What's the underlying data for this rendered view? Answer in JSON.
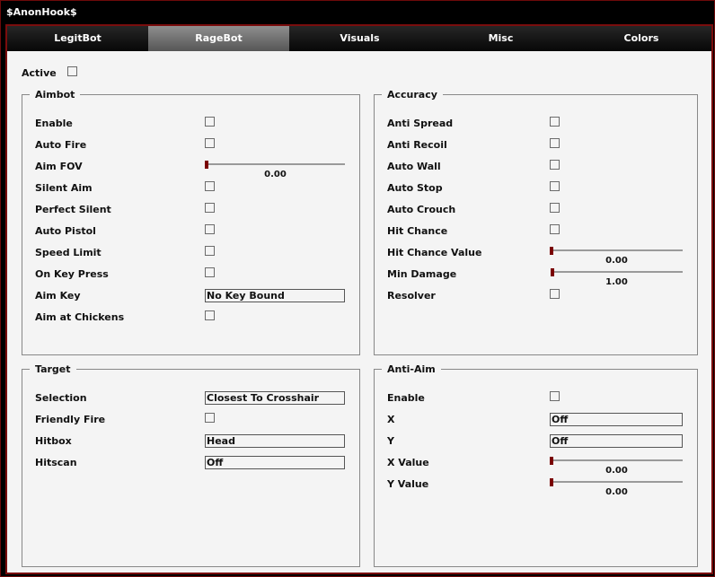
{
  "window": {
    "title": "$AnonHook$"
  },
  "tabs": [
    {
      "label": "LegitBot"
    },
    {
      "label": "RageBot"
    },
    {
      "label": "Visuals"
    },
    {
      "label": "Misc"
    },
    {
      "label": "Colors"
    }
  ],
  "active_tab": "RageBot",
  "active": {
    "label": "Active"
  },
  "aimbot": {
    "title": "Aimbot",
    "enable": "Enable",
    "auto_fire": "Auto Fire",
    "aim_fov": {
      "label": "Aim FOV",
      "value": "0.00"
    },
    "silent_aim": "Silent Aim",
    "perfect_silent": "Perfect Silent",
    "auto_pistol": "Auto Pistol",
    "speed_limit": "Speed Limit",
    "on_key_press": "On Key Press",
    "aim_key": {
      "label": "Aim Key",
      "value": "No Key Bound"
    },
    "aim_chickens": "Aim at Chickens"
  },
  "accuracy": {
    "title": "Accuracy",
    "anti_spread": "Anti Spread",
    "anti_recoil": "Anti Recoil",
    "auto_wall": "Auto Wall",
    "auto_stop": "Auto Stop",
    "auto_crouch": "Auto Crouch",
    "hit_chance": "Hit Chance",
    "hit_chance_value": {
      "label": "Hit Chance Value",
      "value": "0.00"
    },
    "min_damage": {
      "label": "Min Damage",
      "value": "1.00"
    },
    "resolver": "Resolver"
  },
  "target": {
    "title": "Target",
    "selection": {
      "label": "Selection",
      "value": "Closest To Crosshair"
    },
    "friendly_fire": "Friendly Fire",
    "hitbox": {
      "label": "Hitbox",
      "value": "Head"
    },
    "hitscan": {
      "label": "Hitscan",
      "value": "Off"
    }
  },
  "antiaim": {
    "title": "Anti-Aim",
    "enable": "Enable",
    "x": {
      "label": "X",
      "value": "Off"
    },
    "y": {
      "label": "Y",
      "value": "Off"
    },
    "x_value": {
      "label": "X Value",
      "value": "0.00"
    },
    "y_value": {
      "label": "Y Value",
      "value": "0.00"
    }
  },
  "colors": {
    "accent": "#7a0d0d",
    "slider_knob": "#7a0000",
    "panel_bg": "#f4f4f4",
    "active_tab": "#6e6e6e"
  }
}
